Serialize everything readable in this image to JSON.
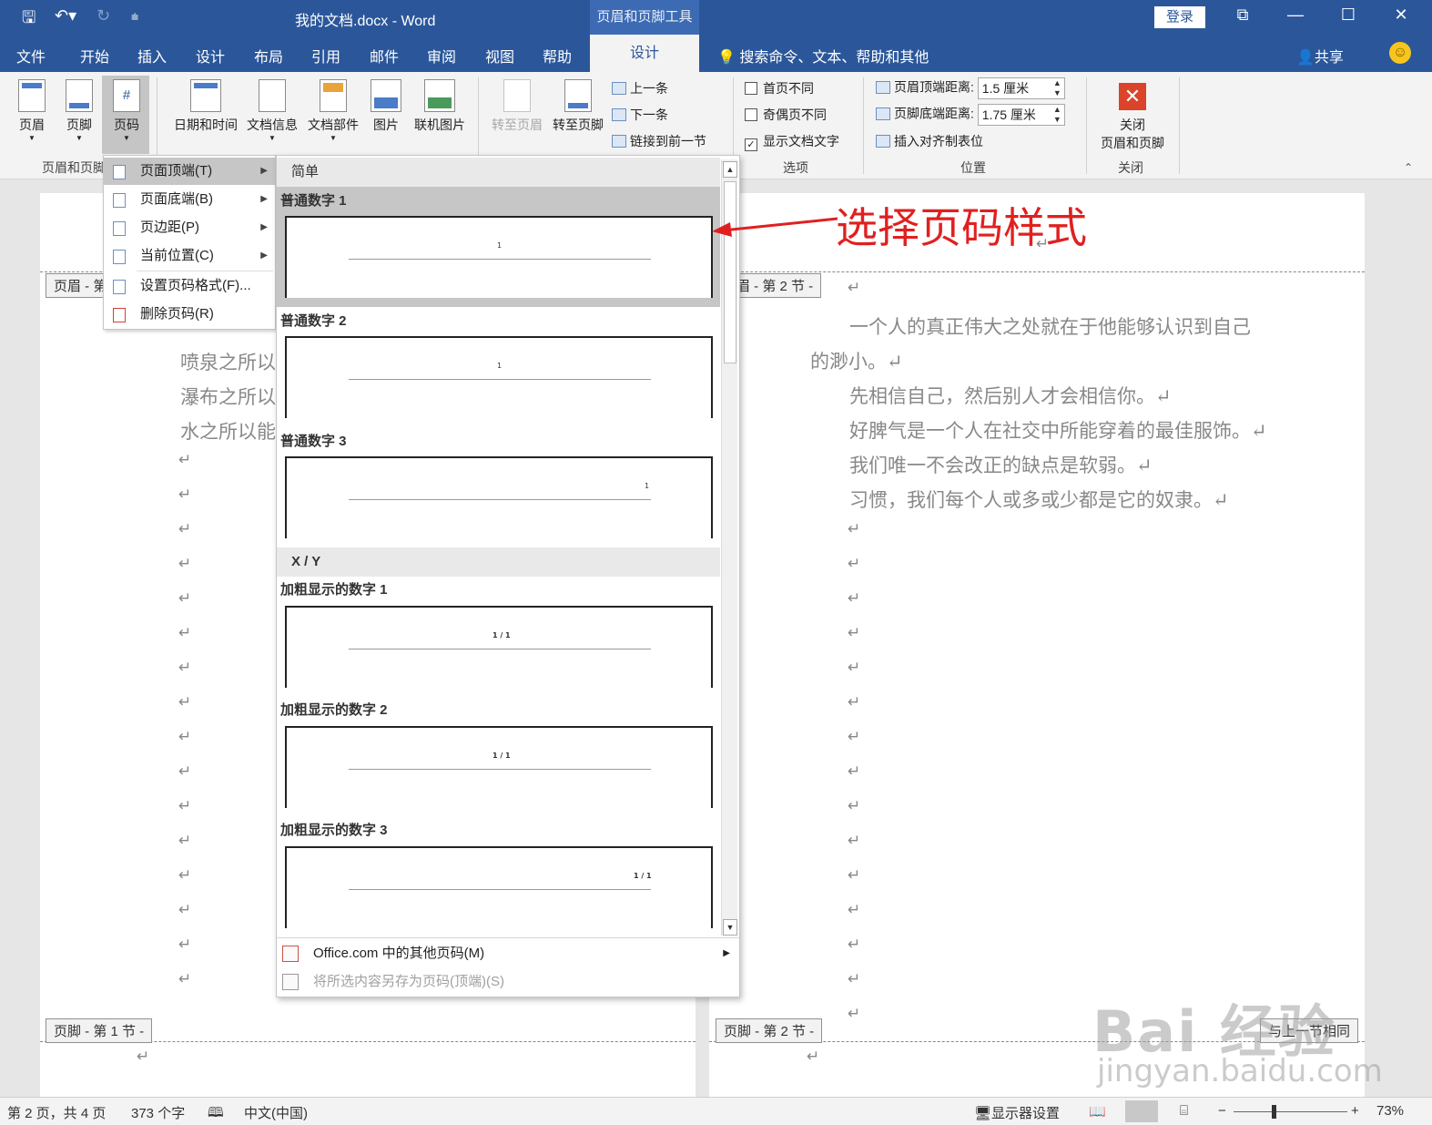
{
  "window": {
    "doc_title": "我的文档.docx  -  Word",
    "context_tools_title": "页眉和页脚工具",
    "login": "登录"
  },
  "tabs": {
    "items": [
      "文件",
      "开始",
      "插入",
      "设计",
      "布局",
      "引用",
      "邮件",
      "审阅",
      "视图",
      "帮助"
    ],
    "active_context": "设计",
    "tell_me": "搜索命令、文本、帮助和其他",
    "share": "共享"
  },
  "ribbon": {
    "header_btn": "页眉",
    "footer_btn": "页脚",
    "page_num_btn": "页码",
    "group_hf": "页眉和页脚",
    "date_time": "日期和时间",
    "doc_info": "文档信息",
    "doc_parts": "文档部件",
    "picture": "图片",
    "online_picture": "联机图片",
    "goto_header": "转至页眉",
    "goto_footer": "转至页脚",
    "prev": "上一条",
    "next": "下一条",
    "link_prev": "链接到前一节",
    "opt_first": "首页不同",
    "opt_oddeven": "奇偶页不同",
    "opt_showtext": "显示文档文字",
    "group_options": "选项",
    "header_dist_label": "页眉顶端距离:",
    "header_dist_value": "1.5 厘米",
    "footer_dist_label": "页脚底端距离:",
    "footer_dist_value": "1.75 厘米",
    "insert_align_tab": "插入对齐制表位",
    "group_position": "位置",
    "close_label_1": "关闭",
    "close_label_2": "页眉和页脚",
    "group_close": "关闭"
  },
  "submenu": {
    "items": [
      "页面顶端(T)",
      "页面底端(B)",
      "页边距(P)",
      "当前位置(C)",
      "设置页码格式(F)...",
      "删除页码(R)"
    ]
  },
  "gallery": {
    "cat_simple": "简单",
    "cat_xy": "X / Y",
    "items": [
      "普通数字 1",
      "普通数字 2",
      "普通数字 3",
      "加粗显示的数字 1",
      "加粗显示的数字 2",
      "加粗显示的数字 3"
    ],
    "num_simple": "1",
    "num_xy": "1 / 1",
    "more": "Office.com 中的其他页码(M)",
    "save_selection": "将所选内容另存为页码(顶端)(S)"
  },
  "annotation": "选择页码样式",
  "doc": {
    "left_header_tag": "页眉 - 第",
    "right_header_tag": "眉 - 第 2 节 -",
    "left_footer_tag": "页脚 - 第 1 节 -",
    "right_footer_tag": "页脚 - 第 2 节 -",
    "same_as_prev": "与上一节相同",
    "left_paras": [
      "喷泉之所以",
      "瀑布之所以",
      "水之所以能"
    ],
    "right_paras": [
      "一个人的真正伟大之处就在于他能够认识到自己",
      "的渺小。↵",
      "先相信自己，然后别人才会相信你。↵",
      "好脾气是一个人在社交中所能穿着的最佳服饰。↵",
      "我们唯一不会改正的缺点是软弱。↵",
      "习惯，我们每个人或多或少都是它的奴隶。↵"
    ],
    "return_mark": "↵"
  },
  "status": {
    "page": "第 2 页，共 4 页",
    "words": "373 个字",
    "lang": "中文(中国)",
    "display_settings": "显示器设置",
    "zoom": "73%"
  },
  "watermark": {
    "brand": "Bai 经验",
    "url": "jingyan.baidu.com"
  }
}
